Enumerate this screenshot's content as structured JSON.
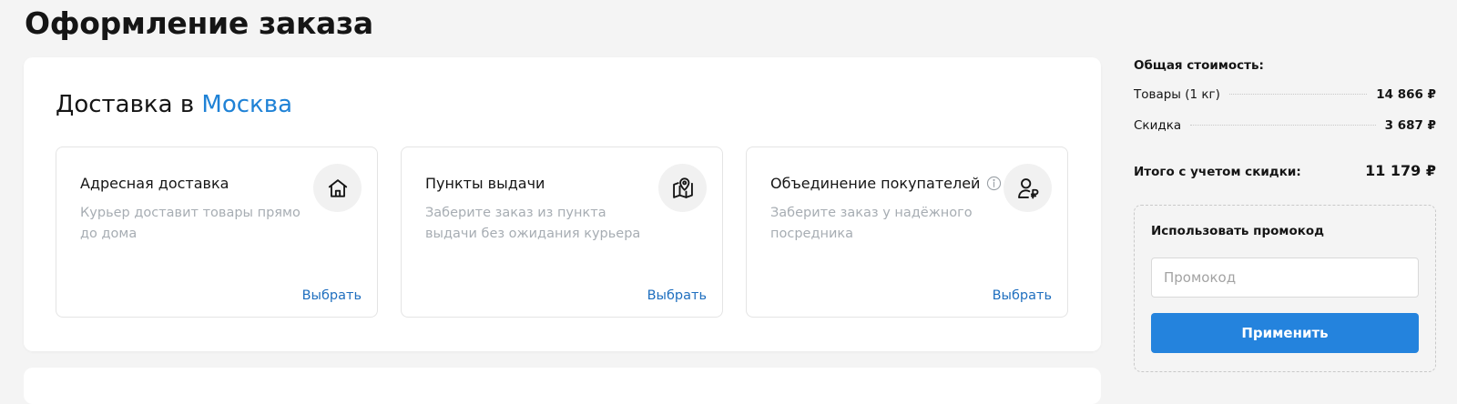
{
  "page": {
    "title": "Оформление заказа"
  },
  "delivery": {
    "title_prefix": "Доставка в",
    "city": "Москва",
    "options": [
      {
        "title": "Адресная доставка",
        "description": "Курьер доставит товары прямо до дома",
        "icon": "home-icon",
        "action": "Выбрать"
      },
      {
        "title": "Пункты выдачи",
        "description": "Заберите заказ из пункта выдачи без ожидания курьера",
        "icon": "map-pin-icon",
        "action": "Выбрать"
      },
      {
        "title": "Объединение покупателей",
        "description": "Заберите заказ у надёжного посредника",
        "icon": "user-ruble-icon",
        "action": "Выбрать",
        "has_info_icon": true
      }
    ]
  },
  "summary": {
    "heading": "Общая стоимость:",
    "rows": [
      {
        "label": "Товары (1 кг)",
        "value": "14 866 ₽"
      },
      {
        "label": "Скидка",
        "value": "3 687 ₽"
      }
    ],
    "total_label": "Итого с учетом скидки:",
    "total_value": "11 179 ₽"
  },
  "promo": {
    "label": "Использовать промокод",
    "placeholder": "Промокод",
    "value": "",
    "button_label": "Применить"
  },
  "colors": {
    "accent": "#2483dd",
    "link": "#1f82d6",
    "background": "#f4f4f4",
    "muted_text": "#a7adb3"
  }
}
